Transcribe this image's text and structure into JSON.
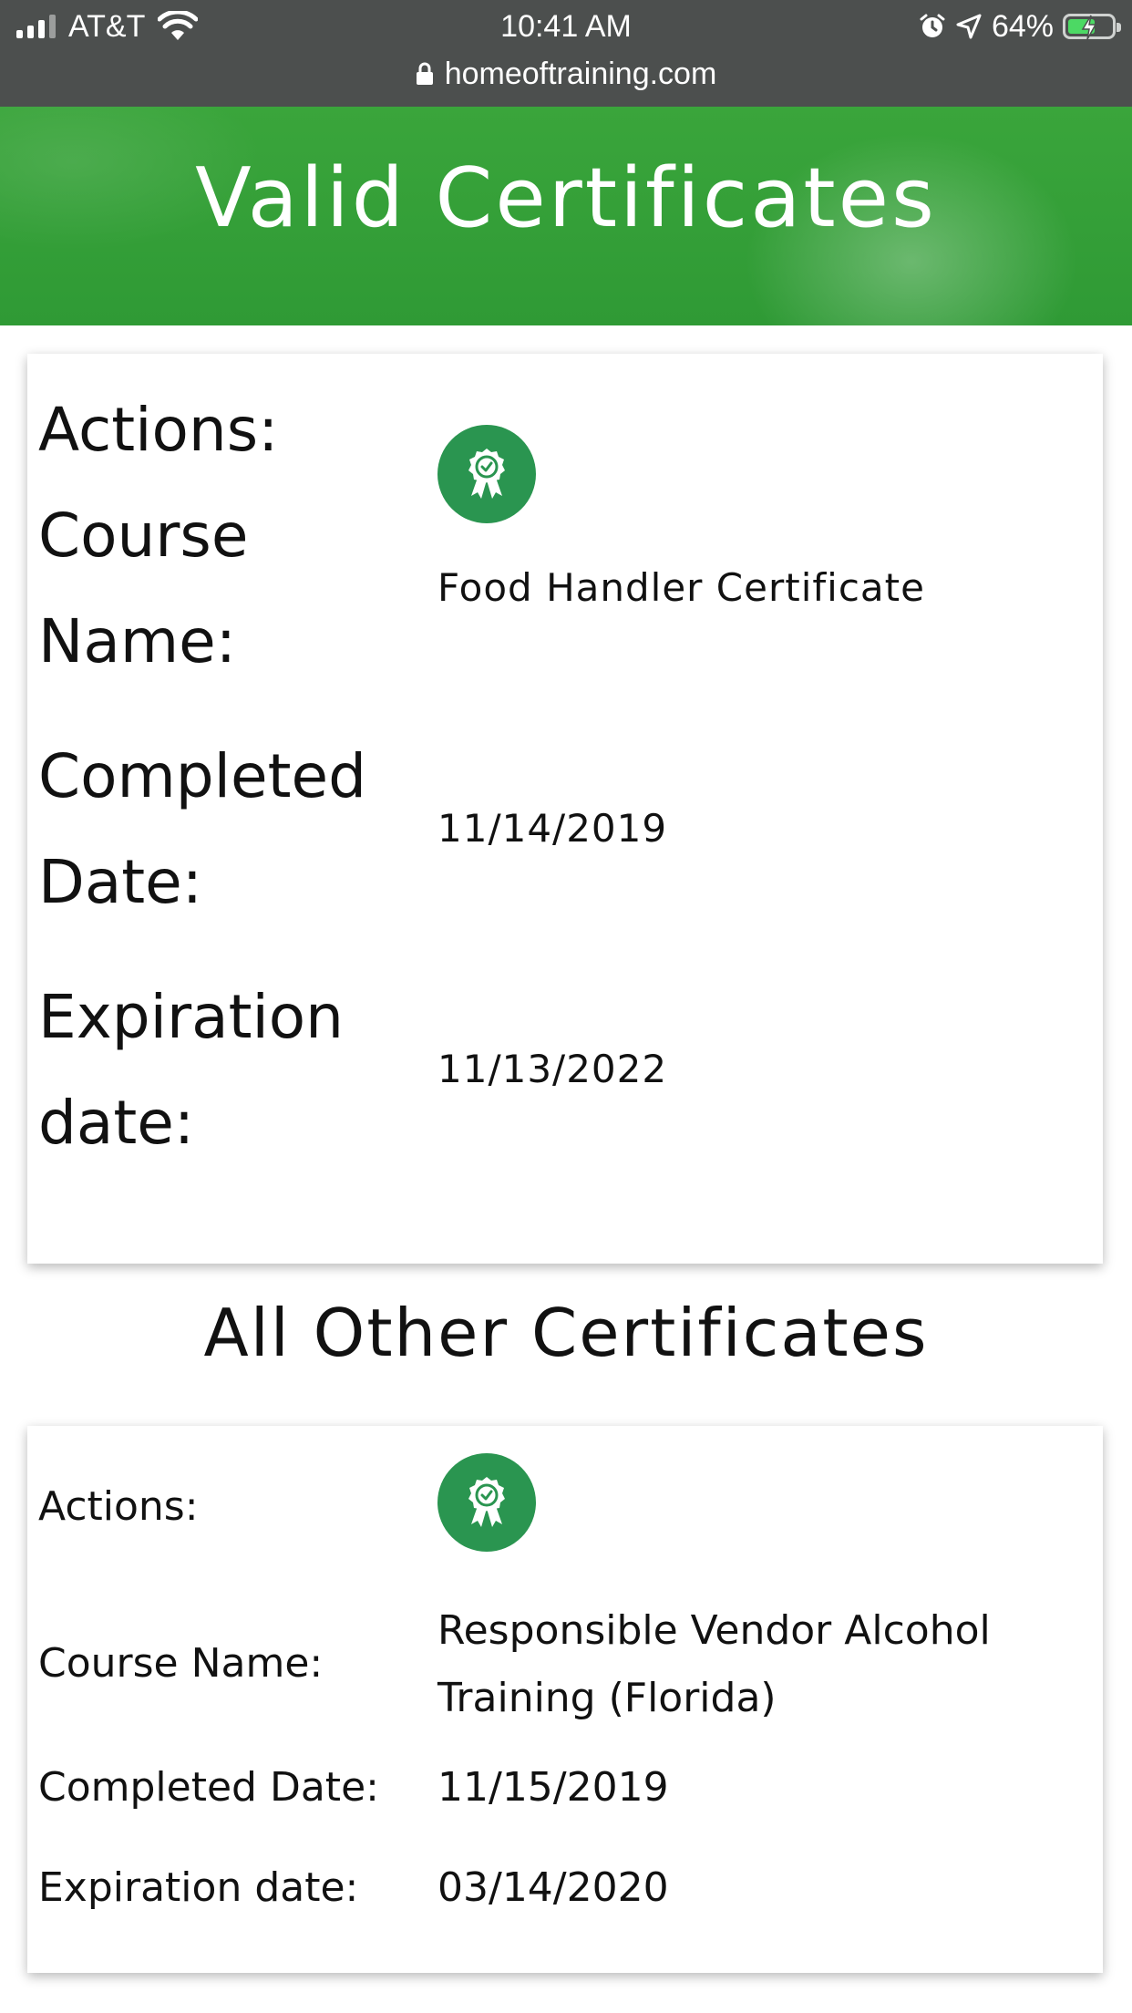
{
  "status_bar": {
    "carrier": "AT&T",
    "time": "10:41 AM",
    "battery_percent": "64%",
    "battery_level": 0.64,
    "icons": [
      "signal-icon",
      "wifi-icon",
      "alarm-icon",
      "location-icon",
      "battery-charging-icon"
    ]
  },
  "browser": {
    "url": "homeoftraining.com",
    "lock_icon": "lock-icon"
  },
  "header": {
    "title": "Valid Certificates"
  },
  "valid_certificates": [
    {
      "actions_label": "Actions:",
      "action_icon": "certificate-badge-icon",
      "course_name_label": "Course Name:",
      "course_name": "Food Handler Certificate",
      "completed_date_label": "Completed Date:",
      "completed_date": "11/14/2019",
      "expiration_date_label": "Expiration date:",
      "expiration_date": "11/13/2022"
    }
  ],
  "other_section": {
    "title": "All Other Certificates"
  },
  "other_certificates": [
    {
      "actions_label": "Actions:",
      "action_icon": "certificate-badge-icon",
      "course_name_label": "Course Name:",
      "course_name": "Responsible Vendor Alcohol Training (Florida)",
      "completed_date_label": "Completed Date:",
      "completed_date": "11/15/2019",
      "expiration_date_label": "Expiration date:",
      "expiration_date": "03/14/2020"
    }
  ],
  "colors": {
    "status_bar_bg": "#4c4f4e",
    "banner_green": "#3aa53b",
    "badge_green": "#2a9550",
    "battery_fill": "#4cd964"
  }
}
